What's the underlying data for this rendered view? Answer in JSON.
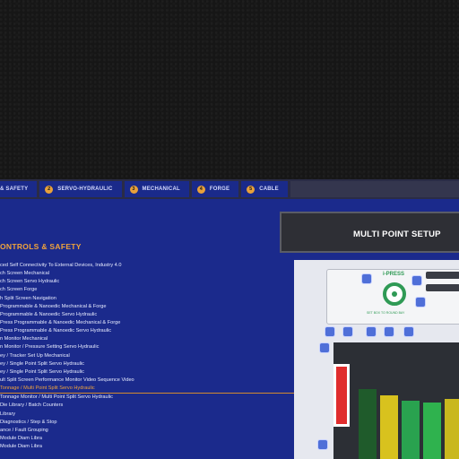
{
  "tabs": [
    {
      "num": "",
      "label": "& SAFETY"
    },
    {
      "num": "2",
      "label": "SERVO-HYDRAULIC"
    },
    {
      "num": "3",
      "label": "MECHANICAL"
    },
    {
      "num": "4",
      "label": "FORGE"
    },
    {
      "num": "5",
      "label": "CABLE"
    }
  ],
  "section_title": "ONTROLS & SAFETY",
  "features": [
    "ced Self Connectivity To External Devices, Industry 4.0",
    "ch Screen Mechanical",
    "ch Screen Servo Hydraulic",
    "ch Screen Forge",
    "h Split Screen Navigation",
    "Programmable & Nanoedic Mechanical & Forge",
    "Programmable & Nanoedic Servo Hydraulic",
    "Press Programmable & Nanoedic Mechanical & Forge",
    "Press Programmable & Nanoedic Servo Hydraulic",
    "n Monitor Mechanical",
    "n Monitor / Pressure Setting Servo Hydraulic",
    "ey / Tracker Set Up Mechanical",
    "ey / Single Point Split Servo Hydraulic",
    "ey / Single Point Split Servo Hydraulic",
    "ult Split Screen Performance Monitor Video Sequence Video",
    "Tonnage / Multi Point Split Servo Hydraulic",
    "Tonnage Monitor / Multi Point Split Servo Hydraulic",
    "Die Library / Batch Counters",
    "Library",
    "Diagnostics / Step & Stop",
    "ance / Fault Grouping",
    "Module Diam Libra",
    "Module Diam Libra"
  ],
  "highlighted_index": 15,
  "header": {
    "title": "MULTI POINT SETUP"
  },
  "press": {
    "label": "i-PRESS",
    "sub": "SET BOX TO ROUND BAY"
  },
  "bars": [
    {
      "head": "",
      "head2": "",
      "fill": 0.0
    },
    {
      "head": "",
      "head2": "",
      "fill": 0.0
    },
    {
      "head": "",
      "head2": "",
      "fill": 0.0
    },
    {
      "head": "",
      "head2": "",
      "fill": 0.0
    },
    {
      "head": "",
      "head2": "",
      "fill": 0.0
    }
  ],
  "colors": {
    "accent": "#f0a33c",
    "panel": "#1b2a8c",
    "green": "#2f9a55",
    "red": "#e02d2d"
  }
}
